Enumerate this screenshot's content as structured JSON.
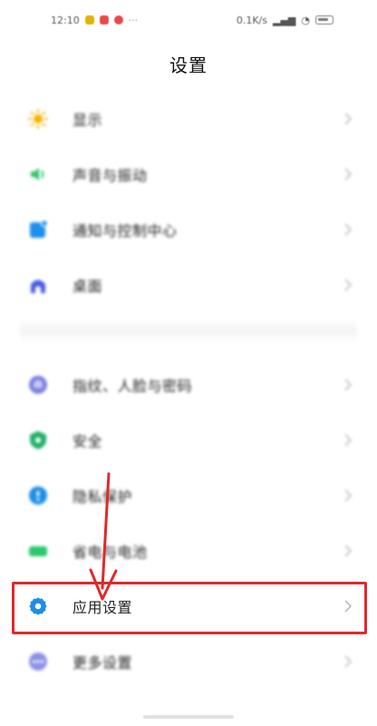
{
  "status_bar": {
    "time": "12:10",
    "network_speed": "0.1K/s",
    "battery_icon": "battery-icon"
  },
  "page": {
    "title": "设置"
  },
  "settings": {
    "items": [
      {
        "label": "显示",
        "icon": "sun-icon",
        "icon_color": "#f5b301"
      },
      {
        "label": "声音与振动",
        "icon": "speaker-icon",
        "icon_color": "#2fc46a"
      },
      {
        "label": "通知与控制中心",
        "icon": "notification-icon",
        "icon_color": "#1d8ff0"
      },
      {
        "label": "桌面",
        "icon": "home-icon",
        "icon_color": "#4b5de0"
      },
      {
        "label": "指纹、人脸与密码",
        "icon": "fingerprint-icon",
        "icon_color": "#7c7fe0"
      },
      {
        "label": "安全",
        "icon": "shield-icon",
        "icon_color": "#22b06a"
      },
      {
        "label": "隐私保护",
        "icon": "privacy-icon",
        "icon_color": "#1b8ee8"
      },
      {
        "label": "省电与电池",
        "icon": "battery-saver-icon",
        "icon_color": "#2cc76d"
      },
      {
        "label": "应用设置",
        "icon": "gear-icon",
        "icon_color": "#1b8ee8"
      },
      {
        "label": "更多设置",
        "icon": "more-icon",
        "icon_color": "#8c91e6"
      }
    ]
  },
  "annotation": {
    "highlight_color": "#e0292b",
    "highlighted_item": "应用设置"
  }
}
